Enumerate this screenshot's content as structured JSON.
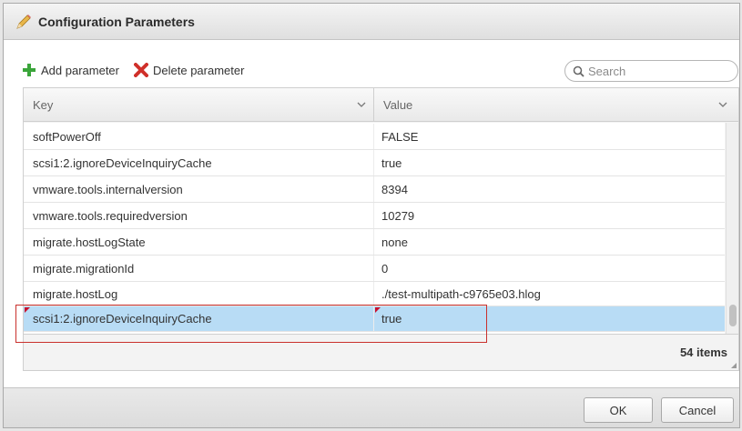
{
  "dialog": {
    "title": "Configuration Parameters"
  },
  "toolbar": {
    "add_label": "Add parameter",
    "delete_label": "Delete parameter"
  },
  "search": {
    "placeholder": "Search"
  },
  "grid": {
    "columns": {
      "key": "Key",
      "value": "Value"
    },
    "rows": [
      {
        "key": "softPowerOff",
        "value": "FALSE"
      },
      {
        "key": "scsi1:2.ignoreDeviceInquiryCache",
        "value": "true"
      },
      {
        "key": "vmware.tools.internalversion",
        "value": "8394"
      },
      {
        "key": "vmware.tools.requiredversion",
        "value": "10279"
      },
      {
        "key": "migrate.hostLogState",
        "value": "none"
      },
      {
        "key": "migrate.migrationId",
        "value": "0"
      },
      {
        "key": "migrate.hostLog",
        "value": "./test-multipath-c9765e03.hlog"
      },
      {
        "key": "scsi1:2.ignoreDeviceInquiryCache",
        "value": "true",
        "selected": true,
        "modified": true
      }
    ],
    "item_count": "54 items"
  },
  "footer": {
    "ok_label": "OK",
    "cancel_label": "Cancel"
  },
  "icons": {
    "title": "pencil-icon",
    "add": "green-plus-icon",
    "delete": "red-x-icon",
    "search": "magnifier-icon",
    "sort": "chevron-down-icon"
  },
  "colors": {
    "selected_row": "#b8dcf5",
    "highlight_border": "#c9302c",
    "add_icon": "#3aa53a",
    "delete_icon": "#d0302a"
  }
}
